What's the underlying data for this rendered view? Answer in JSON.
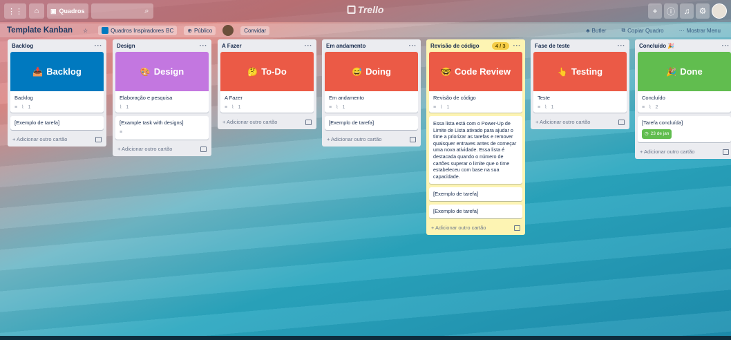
{
  "topbar": {
    "boards_label": "Quadros",
    "logo_text": "Trello"
  },
  "board": {
    "title": "Template Kanban",
    "team": "Quadros Inspiradores",
    "team_badge": "BC",
    "visibility": "Público",
    "invite": "Convidar",
    "butler": "Butler",
    "copy_board": "Copiar Quadro",
    "show_menu": "Mostrar Menu"
  },
  "common": {
    "add_card": "+ Adicionar outro cartão",
    "menu_dots": "···"
  },
  "lists": [
    {
      "name": "Backlog",
      "cover_text": "Backlog",
      "cover_color": "#0079bf",
      "card_title": "Backlog",
      "badge_count": "1",
      "cards": [
        "[Exemplo de tarefa]"
      ]
    },
    {
      "name": "Design",
      "cover_text": "Design",
      "cover_color": "#c377e0",
      "card_title": "Elaboração e pesquisa",
      "badge_count": "1",
      "cards": [
        "[Example task with designs]"
      ]
    },
    {
      "name": "A Fazer",
      "cover_text": "To-Do",
      "cover_color": "#eb5a46",
      "card_title": "A Fazer",
      "badge_count": "1",
      "cards": []
    },
    {
      "name": "Em andamento",
      "cover_text": "Doing",
      "cover_color": "#eb5a46",
      "card_title": "Em andamento",
      "badge_count": "1",
      "cards": [
        "[Exemplo de tarefa]"
      ]
    },
    {
      "name": "Revisão de código",
      "limit": "4 / 3",
      "cover_text": "Code Review",
      "cover_color": "#eb5a46",
      "card_title": "Revisão de código",
      "badge_count": "1",
      "description": "Essa lista está com o Power-Up de Limite de Lista ativado para ajudar o time a priorizar as tarefas e remover quaisquer entraves antes de começar uma nova atividade. Essa lista é destacada quando o número de cartões superar o limite que o time estabeleceu com base na sua capacidade.",
      "cards": [
        "[Exemplo de tarefa]",
        "[Exemplo de tarefa]"
      ]
    },
    {
      "name": "Fase de teste",
      "cover_text": "Testing",
      "cover_color": "#eb5a46",
      "card_title": "Teste",
      "badge_count": "1",
      "cards": []
    },
    {
      "name": "Concluído 🎉",
      "cover_text": "Done",
      "cover_color": "#61bd4f",
      "card_title": "Concluído",
      "badge_count": "2",
      "cards": [
        "[Tarefa concluída]"
      ],
      "due": "23 de jan"
    }
  ]
}
